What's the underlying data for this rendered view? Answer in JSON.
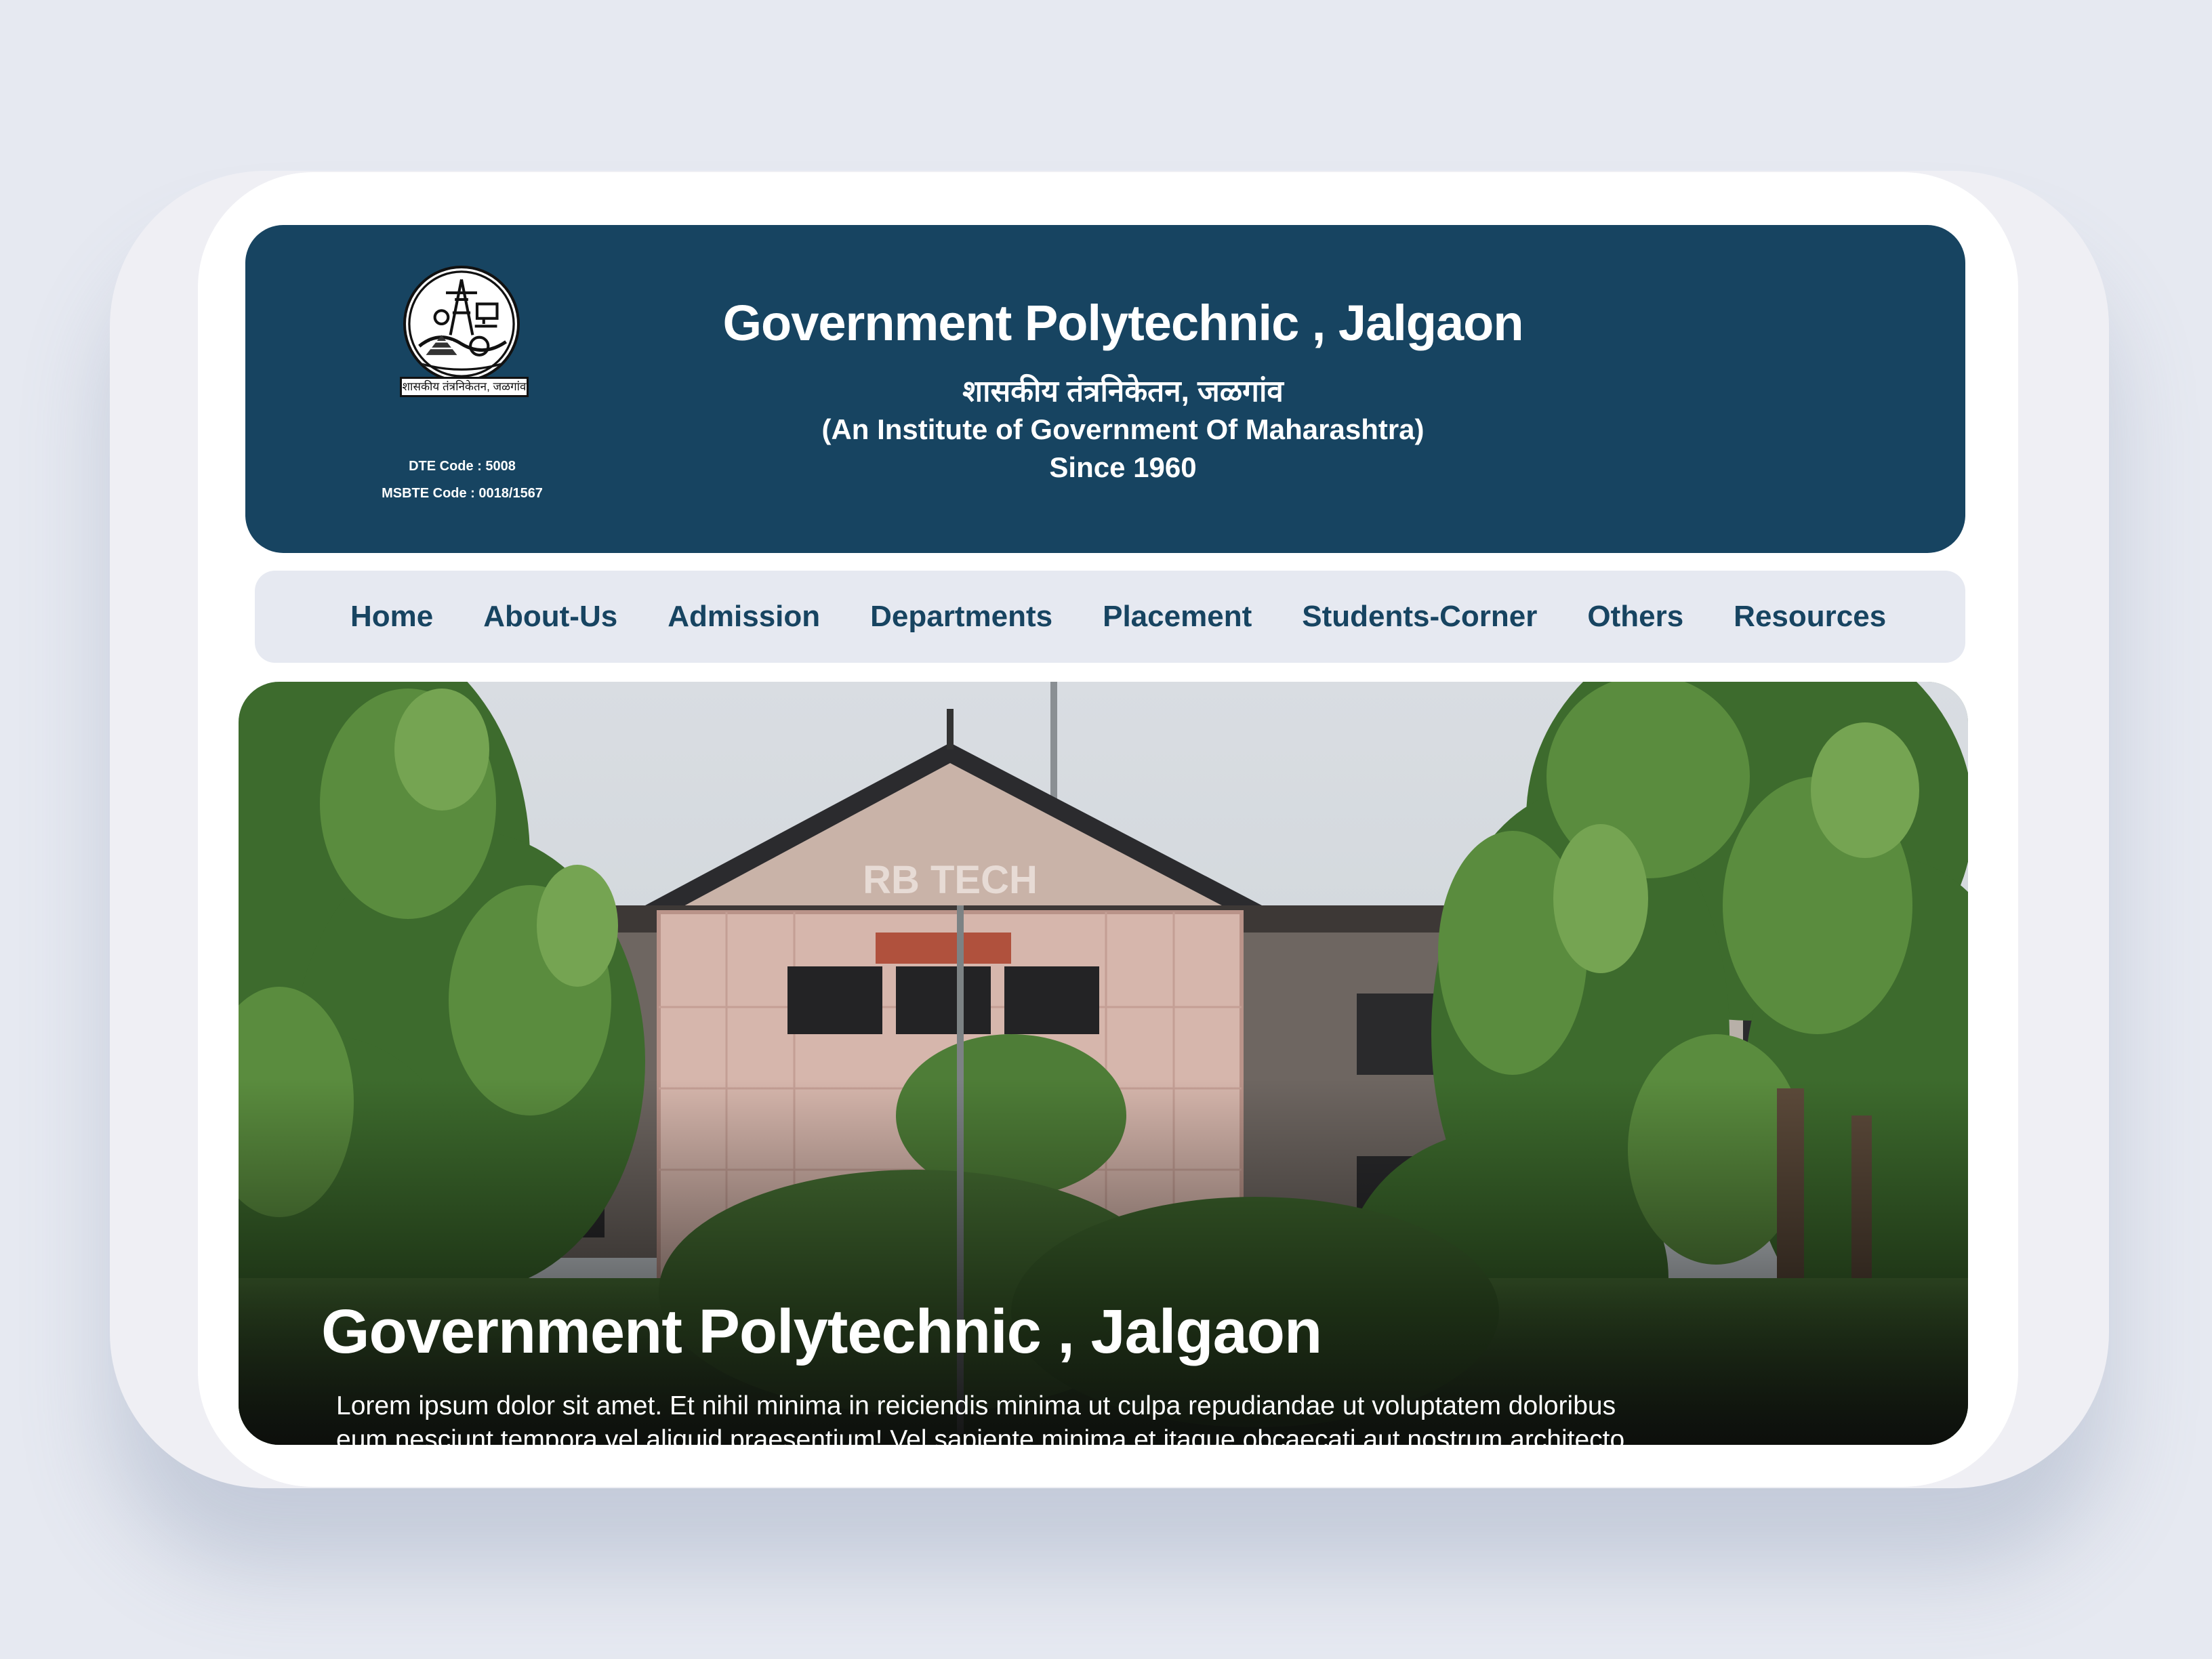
{
  "header": {
    "title": "Government Polytechnic , Jalgaon",
    "marathi_name": "शासकीय तंत्रनिकेतन, जळगांव",
    "subtitle": "(An Institute of Government Of Maharashtra)",
    "since": "Since 1960",
    "emblem_caption": "शासकीय तंत्रनिकेतन, जळगांव",
    "dte_code": "DTE Code : 5008",
    "msbte_code": "MSBTE Code : 0018/1567"
  },
  "nav": {
    "items": [
      {
        "label": "Home"
      },
      {
        "label": "About-Us"
      },
      {
        "label": "Admission"
      },
      {
        "label": "Departments"
      },
      {
        "label": "Placement"
      },
      {
        "label": "Students-Corner"
      },
      {
        "label": "Others"
      },
      {
        "label": "Resources"
      }
    ]
  },
  "hero": {
    "title": "Government Polytechnic , Jalgaon",
    "text": "Lorem ipsum dolor sit amet. Et nihil minima in reiciendis minima ut culpa repudiandae ut voluptatem doloribus eum nesciunt tempora vel aliquid praesentium! Vel sapiente minima et itaque obcaecati aut nostrum architecto hic internos quia est earum inventore.",
    "building_sign": "RB TECH"
  },
  "colors": {
    "brand_navy": "#174461",
    "nav_background": "#e6e9f1",
    "page_background": "#e6e9f1"
  },
  "icons": {
    "emblem": "college-emblem-icon"
  }
}
